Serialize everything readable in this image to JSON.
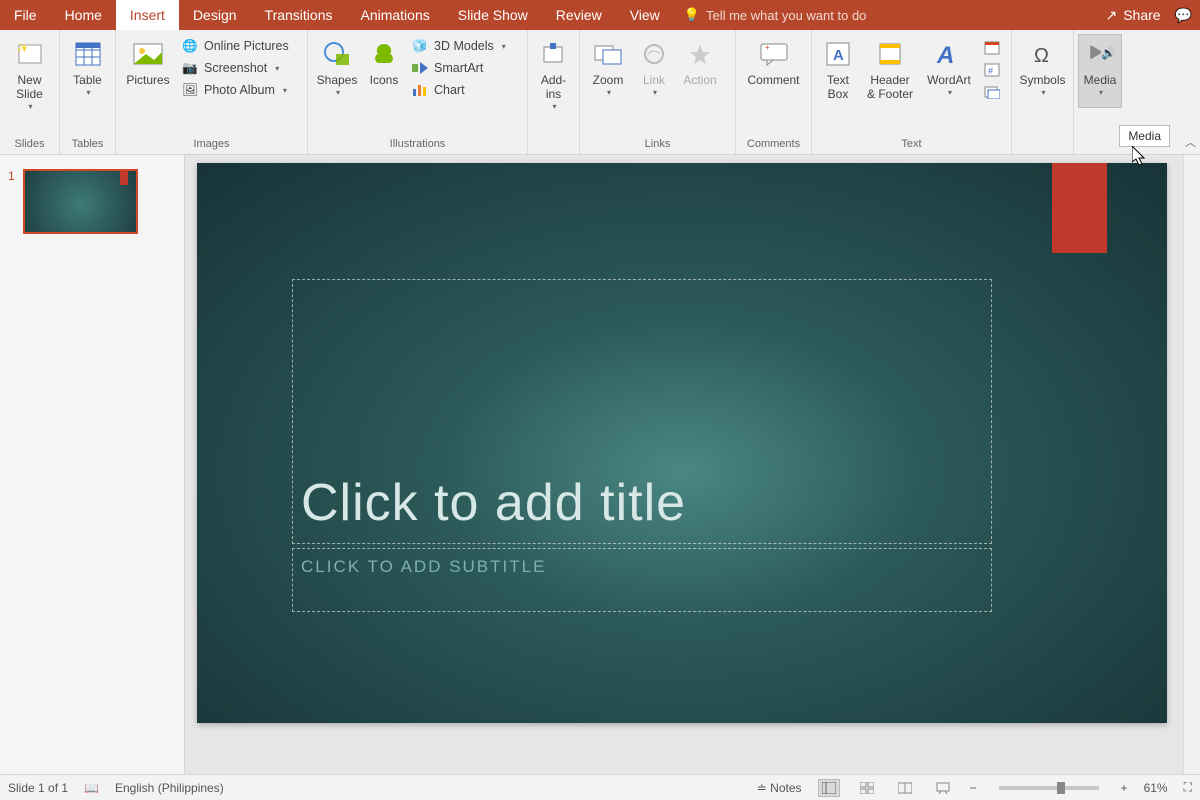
{
  "tabs": {
    "items": [
      "File",
      "Home",
      "Insert",
      "Design",
      "Transitions",
      "Animations",
      "Slide Show",
      "Review",
      "View"
    ],
    "active_index": 2,
    "tell_me": "Tell me what you want to do",
    "share": "Share"
  },
  "ribbon": {
    "groups": {
      "slides": {
        "label": "Slides",
        "new_slide": "New\nSlide"
      },
      "tables": {
        "label": "Tables",
        "table": "Table"
      },
      "images": {
        "label": "Images",
        "pictures": "Pictures",
        "online_pictures": "Online Pictures",
        "screenshot": "Screenshot",
        "photo_album": "Photo Album"
      },
      "illustrations": {
        "label": "Illustrations",
        "shapes": "Shapes",
        "icons": "Icons",
        "models3d": "3D Models",
        "smartart": "SmartArt",
        "chart": "Chart"
      },
      "addins": {
        "label": "",
        "addins": "Add-\nins"
      },
      "links": {
        "label": "Links",
        "zoom": "Zoom",
        "link": "Link",
        "action": "Action"
      },
      "comments": {
        "label": "Comments",
        "comment": "Comment"
      },
      "text": {
        "label": "Text",
        "text_box": "Text\nBox",
        "header_footer": "Header\n& Footer",
        "wordart": "WordArt"
      },
      "symbols": {
        "label": "",
        "symbols": "Symbols"
      },
      "media": {
        "label": "",
        "media": "Media",
        "tooltip": "Media"
      }
    }
  },
  "thumbnails": {
    "items": [
      {
        "num": "1"
      }
    ]
  },
  "slide": {
    "title_placeholder": "Click to add title",
    "subtitle_placeholder": "CLICK TO ADD SUBTITLE"
  },
  "status": {
    "slide_info": "Slide 1 of 1",
    "language": "English (Philippines)",
    "notes": "Notes",
    "zoom": "61%"
  }
}
